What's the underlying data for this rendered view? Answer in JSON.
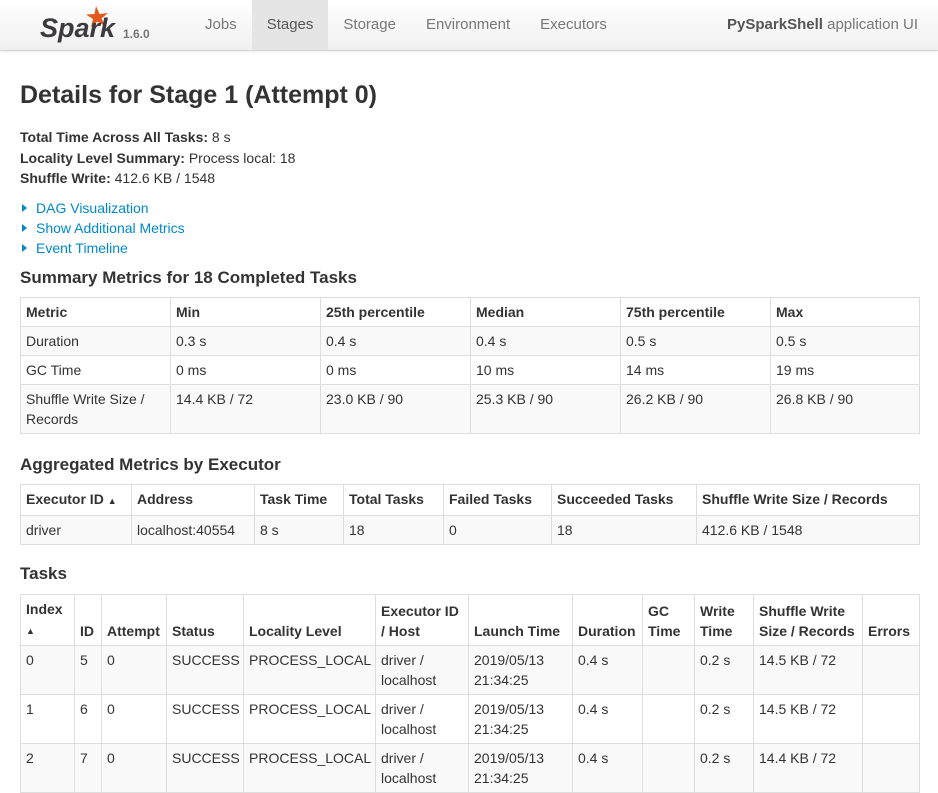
{
  "nav": {
    "brand": "Spark",
    "version": "1.6.0",
    "tabs": [
      {
        "label": "Jobs"
      },
      {
        "label": "Stages"
      },
      {
        "label": "Storage"
      },
      {
        "label": "Environment"
      },
      {
        "label": "Executors"
      }
    ],
    "app_name": "PySparkShell",
    "app_suffix": " application UI"
  },
  "page_title": "Details for Stage 1 (Attempt 0)",
  "summary": [
    {
      "label": "Total Time Across All Tasks:",
      "value": " 8 s"
    },
    {
      "label": "Locality Level Summary:",
      "value": " Process local: 18"
    },
    {
      "label": "Shuffle Write:",
      "value": " 412.6 KB / 1548"
    }
  ],
  "toggles": [
    "DAG Visualization",
    "Show Additional Metrics",
    "Event Timeline"
  ],
  "summary_metrics": {
    "title": "Summary Metrics for 18 Completed Tasks",
    "headers": [
      "Metric",
      "Min",
      "25th percentile",
      "Median",
      "75th percentile",
      "Max"
    ],
    "rows": [
      [
        "Duration",
        "0.3 s",
        "0.4 s",
        "0.4 s",
        "0.5 s",
        "0.5 s"
      ],
      [
        "GC Time",
        "0 ms",
        "0 ms",
        "10 ms",
        "14 ms",
        "19 ms"
      ],
      [
        "Shuffle Write Size / Records",
        "14.4 KB / 72",
        "23.0 KB / 90",
        "25.3 KB / 90",
        "26.2 KB / 90",
        "26.8 KB / 90"
      ]
    ]
  },
  "executor_metrics": {
    "title": "Aggregated Metrics by Executor",
    "headers": [
      "Executor ID",
      "Address",
      "Task Time",
      "Total Tasks",
      "Failed Tasks",
      "Succeeded Tasks",
      "Shuffle Write Size / Records"
    ],
    "sort_arrow": "▲",
    "rows": [
      [
        "driver",
        "localhost:40554",
        "8 s",
        "18",
        "0",
        "18",
        "412.6 KB / 1548"
      ]
    ]
  },
  "tasks": {
    "title": "Tasks",
    "headers": [
      "Index",
      "ID",
      "Attempt",
      "Status",
      "Locality Level",
      "Executor ID / Host",
      "Launch Time",
      "Duration",
      "GC Time",
      "Write Time",
      "Shuffle Write Size / Records",
      "Errors"
    ],
    "sort_arrow": "▲",
    "rows": [
      [
        "0",
        "5",
        "0",
        "SUCCESS",
        "PROCESS_LOCAL",
        "driver / localhost",
        "2019/05/13 21:34:25",
        "0.4 s",
        "",
        "0.2 s",
        "14.5 KB / 72",
        ""
      ],
      [
        "1",
        "6",
        "0",
        "SUCCESS",
        "PROCESS_LOCAL",
        "driver / localhost",
        "2019/05/13 21:34:25",
        "0.4 s",
        "",
        "0.2 s",
        "14.5 KB / 72",
        ""
      ],
      [
        "2",
        "7",
        "0",
        "SUCCESS",
        "PROCESS_LOCAL",
        "driver / localhost",
        "2019/05/13 21:34:25",
        "0.4 s",
        "",
        "0.2 s",
        "14.4 KB / 72",
        ""
      ]
    ]
  },
  "colors": {
    "link": "#0088cc",
    "brand_orange": "#e25a1c",
    "brand_text": "#3c3a3e"
  }
}
